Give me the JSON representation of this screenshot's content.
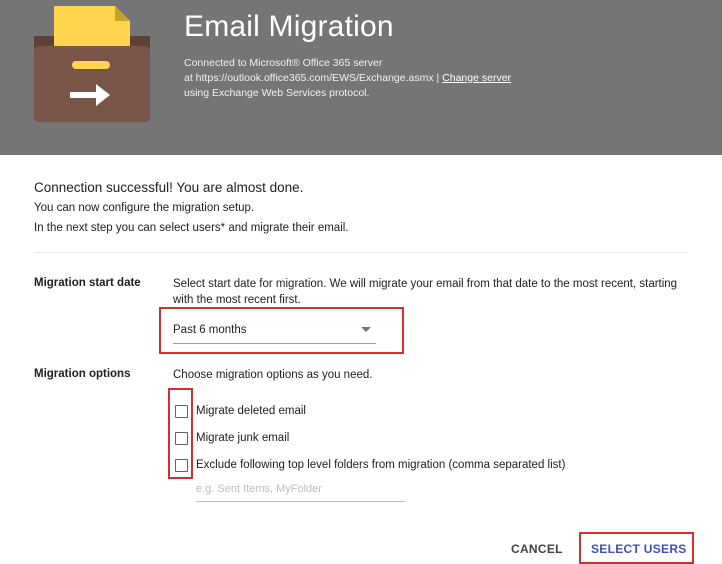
{
  "header": {
    "title": "Email Migration",
    "line1": "Connected to Microsoft® Office 365 server",
    "line2_prefix": "at https://outlook.office365.com/EWS/Exchange.asmx |",
    "change_server_link": "Change server",
    "line3": "using Exchange Web Services protocol.",
    "icon": "inbox-folder-arrow-icon"
  },
  "status": {
    "title": "Connection successful! You are almost done.",
    "line1": "You can now configure the migration setup.",
    "line2": "In the next step you can select users* and migrate their email."
  },
  "start_date": {
    "label": "Migration start date",
    "description": "Select start date for migration. We will migrate your email from that date to the most recent, starting with the most recent first.",
    "selected": "Past 6 months",
    "dropdown_icon": "dropdown-arrow-icon"
  },
  "options": {
    "label": "Migration options",
    "description": "Choose migration options as you need.",
    "items": [
      {
        "label": "Migrate deleted email",
        "checked": false
      },
      {
        "label": "Migrate junk email",
        "checked": false
      },
      {
        "label": "Exclude following top level folders from migration (comma separated list)",
        "checked": false
      }
    ],
    "folders_placeholder": "e.g. Sent Items, MyFolder",
    "folders_value": ""
  },
  "actions": {
    "cancel": "CANCEL",
    "select_users": "SELECT USERS"
  },
  "colors": {
    "header_bg": "#757575",
    "accent": "#3f51b5",
    "highlight": "#d32f2f",
    "folder_brown": "#795548",
    "folder_yellow": "#ffd54f"
  }
}
